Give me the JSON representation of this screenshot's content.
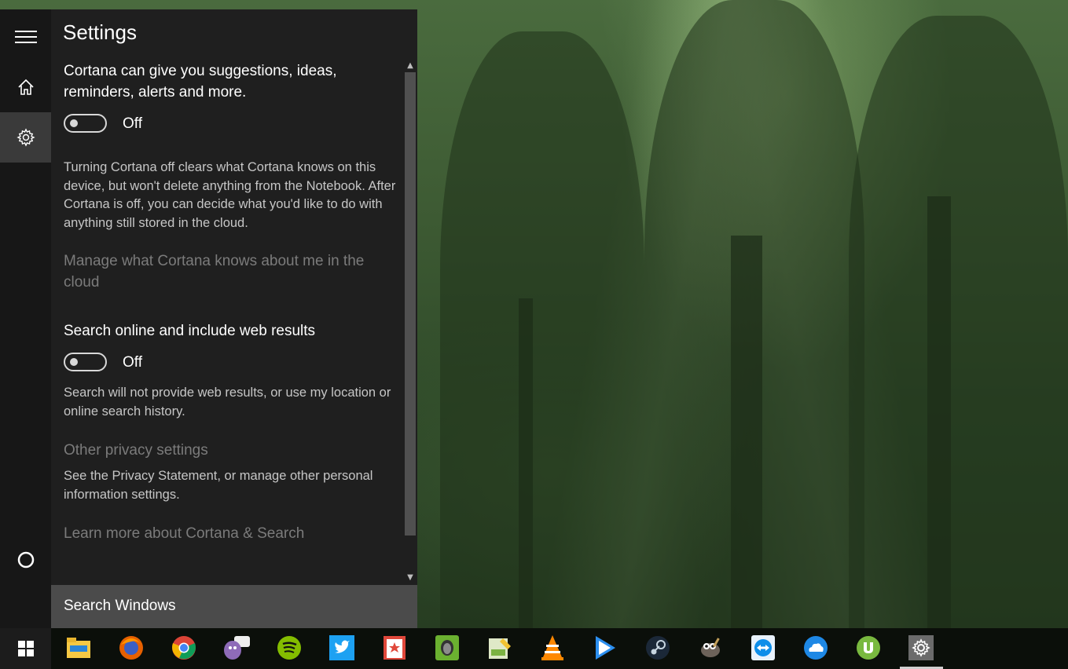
{
  "panel": {
    "title": "Settings",
    "cortana": {
      "heading": "Cortana can give you suggestions, ideas, reminders, alerts and more.",
      "toggle_label": "Off",
      "toggle_on": false,
      "description": "Turning Cortana off clears what Cortana knows on this device, but won't delete anything from the Notebook. After Cortana is off, you can decide what you'd like to do with anything still stored in the cloud.",
      "manage_link": "Manage what Cortana knows about me in the cloud"
    },
    "web": {
      "heading": "Search online and include web results",
      "toggle_label": "Off",
      "toggle_on": false,
      "description": "Search will not provide web results, or use my location or online search history."
    },
    "privacy": {
      "link": "Other privacy settings",
      "description": "See the Privacy Statement, or manage other personal information settings."
    },
    "learn_more_link": "Learn more about Cortana & Search",
    "search_box": "Search Windows"
  },
  "nav": {
    "items": [
      "hamburger-menu-icon",
      "home-icon",
      "settings-gear-icon",
      "cortana-circle-icon"
    ],
    "active": "settings-gear-icon"
  },
  "taskbar": {
    "apps": [
      "file-explorer-icon",
      "firefox-icon",
      "chrome-icon",
      "pidgin-icon",
      "spotify-icon",
      "twitter-icon",
      "bookmark-app-icon",
      "evernote-icon",
      "notepad-icon",
      "vlc-icon",
      "media-player-icon",
      "steam-icon",
      "gimp-icon",
      "teamviewer-icon",
      "cloud-icon",
      "utorrent-icon",
      "settings-icon"
    ],
    "active_app": "settings-icon"
  },
  "colors": {
    "panel_bg": "#1f1f1f",
    "nav_bg": "#171717",
    "nav_active": "#3a3a3a",
    "search_bg": "#4b4b4b",
    "link_gray": "#7b7b7b"
  }
}
